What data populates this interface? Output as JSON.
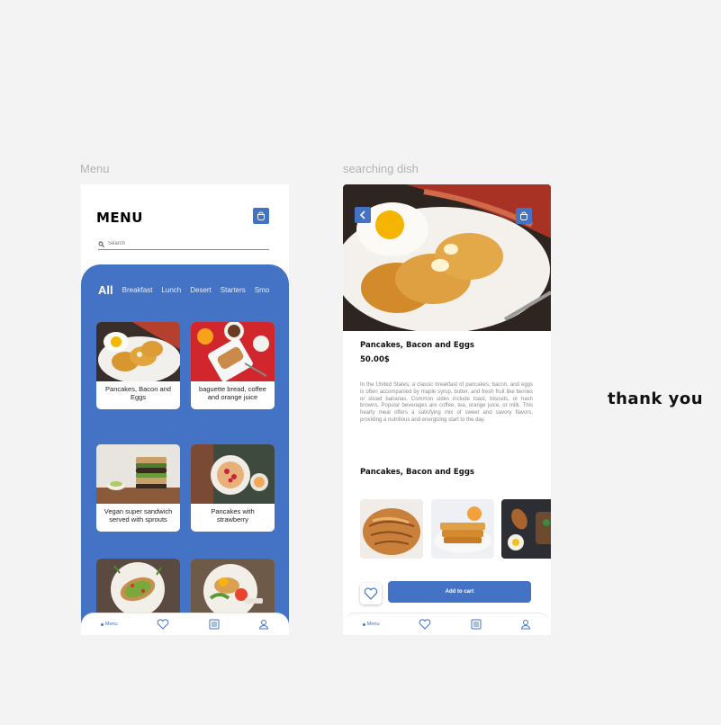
{
  "frames": {
    "menu_label": "Menu",
    "search_label": "searching dish"
  },
  "menu_screen": {
    "title": "MENU",
    "search_placeholder": "Search",
    "categories": [
      "All",
      "Breakfast",
      "Lunch",
      "Desert",
      "Starters",
      "Smo"
    ],
    "cards": [
      {
        "name": "Pancakes, Bacon and Eggs"
      },
      {
        "name": "baguette bread, coffee and orange juice"
      },
      {
        "name": "Vegan super sandwich served with sprouts"
      },
      {
        "name": "Pancakes with strawberry"
      },
      {
        "name": ""
      },
      {
        "name": ""
      }
    ],
    "nav": {
      "active_label": "Menu"
    }
  },
  "dish_screen": {
    "title": "Pancakes, Bacon and Eggs",
    "price": "50.00$",
    "description": "In the United States, a classic breakfast of pancakes, bacon, and eggs is often accompanied by maple syrup, butter, and fresh fruit like berries or sliced bananas. Common sides include toast, biscuits, or hash browns. Popular beverages are coffee, tea, orange juice, or milk. This hearty meal offers a satisfying mix of sweet and savory flavors, providing a nutritious and energizing start to the day.",
    "subtitle": "Pancakes, Bacon and Eggs",
    "add_to_cart": "Add to cart",
    "nav": {
      "active_label": "Menu"
    }
  },
  "thank_you": "thank you",
  "colors": {
    "accent": "#4472c4",
    "background": "#f3f3f3"
  }
}
